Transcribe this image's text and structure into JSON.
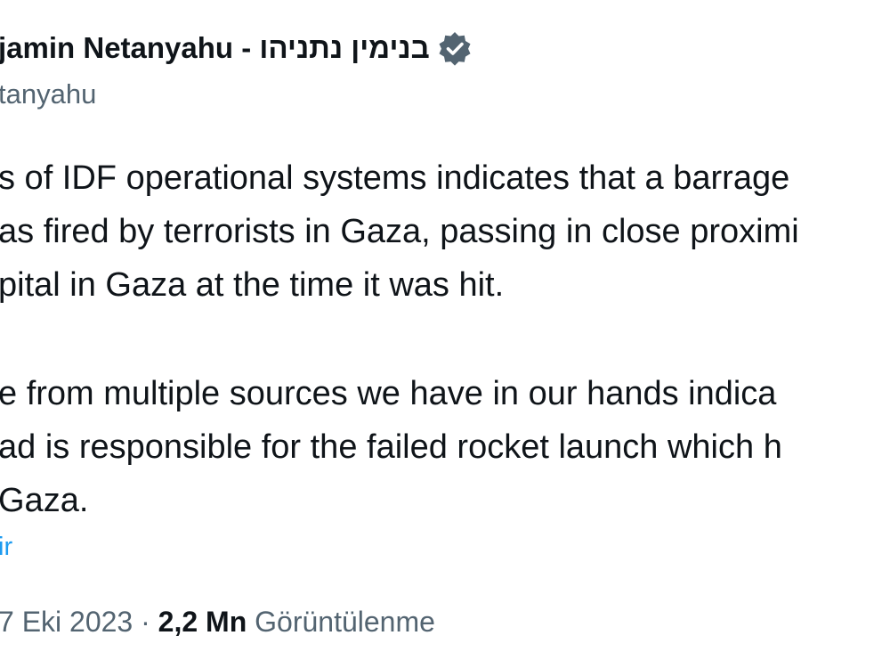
{
  "author": {
    "display_name": "jamin Netanyahu - בנימין נתניהו",
    "handle": "tanyahu",
    "verified_icon": "verified-badge-icon",
    "verified_color": "#536471"
  },
  "tweet": {
    "lines_paragraph_1": [
      "s of IDF operational systems indicates that a barrage",
      "as fired by terrorists in Gaza, passing in close proximi",
      "pital in Gaza at the time it was hit."
    ],
    "lines_paragraph_2": [
      "e from multiple sources we have in our hands indica",
      "ad is responsible for the failed rocket launch which h",
      " Gaza."
    ],
    "translate_label": "ir"
  },
  "meta": {
    "date": "7 Eki 2023",
    "separator": "·",
    "views_count": "2,2 Mn",
    "views_label": "Görüntülenme"
  },
  "colors": {
    "text": "#0f1419",
    "secondary": "#536471",
    "link": "#1d9bf0"
  }
}
